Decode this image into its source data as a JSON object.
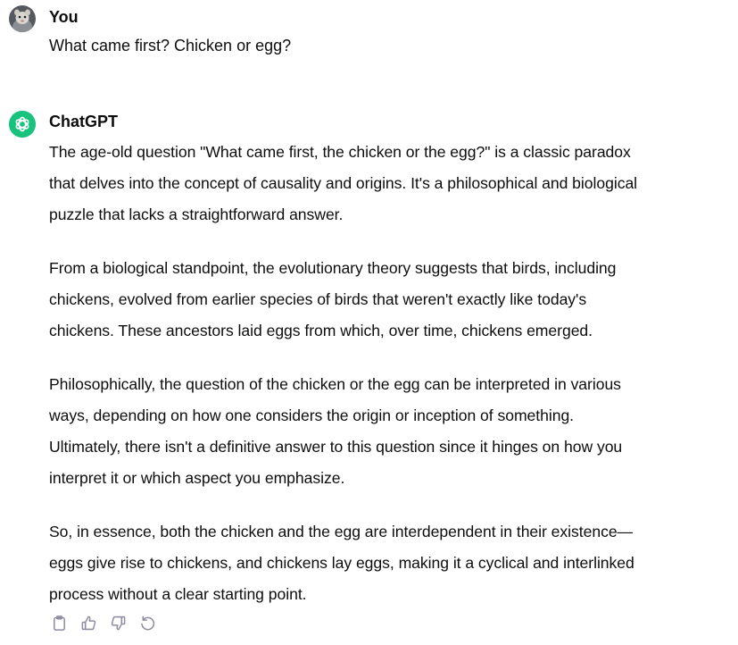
{
  "conversation": {
    "user": {
      "name": "You",
      "message": "What came first? Chicken or egg?"
    },
    "assistant": {
      "name": "ChatGPT",
      "paragraphs": [
        "The age-old question \"What came first, the chicken or the egg?\" is a classic paradox\nthat delves into the concept of causality and origins. It's a philosophical and biological\npuzzle that lacks a straightforward answer.",
        "From a biological standpoint, the evolutionary theory suggests that birds, including\nchickens, evolved from earlier species of birds that weren't exactly like today's\nchickens. These ancestors laid eggs from which, over time, chickens emerged.",
        "Philosophically, the question of the chicken or the egg can be interpreted in various\nways, depending on how one considers the origin or inception of something.\nUltimately, there isn't a definitive answer to this question since it hinges on how you\ninterpret it or which aspect you emphasize.",
        "So, in essence, both the chicken and the egg are interdependent in their existence—\neggs give rise to chickens, and chickens lay eggs, making it a cyclical and interlinked\nprocess without a clear starting point."
      ]
    }
  },
  "actions": {
    "icons": [
      "clipboard-icon",
      "thumbs-up-icon",
      "thumbs-down-icon",
      "regenerate-icon"
    ]
  },
  "colors": {
    "text": "#0d0d0d",
    "icon": "#8e8ea0",
    "assistant_avatar_bg": "#19c37d"
  }
}
